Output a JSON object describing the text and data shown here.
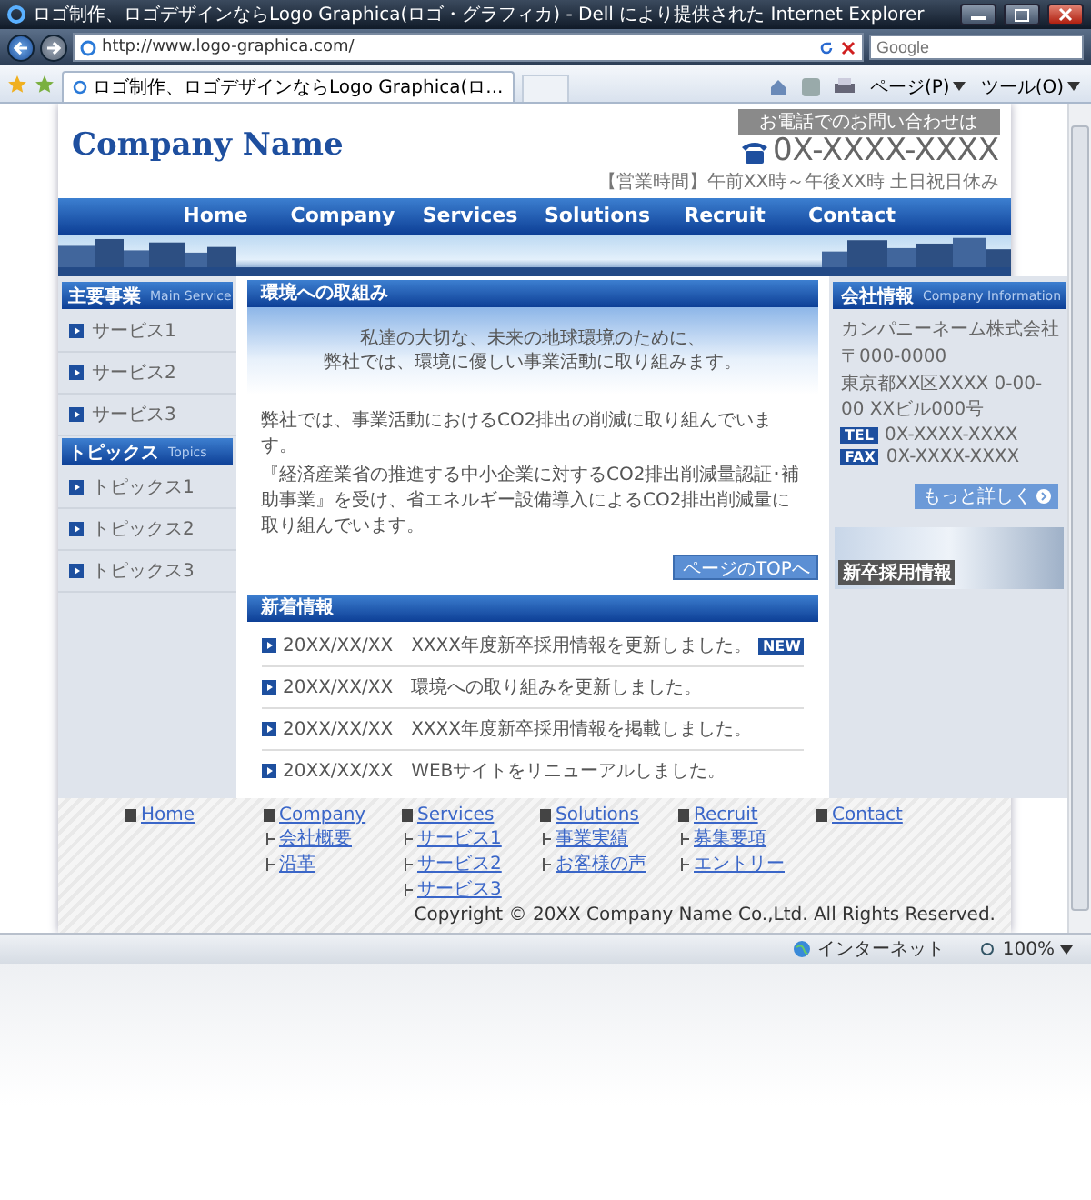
{
  "browser": {
    "title": "ロゴ制作、ロゴデザインならLogo Graphica(ロゴ・グラフィカ) - Dell により提供された Internet Explorer",
    "address": "http://www.logo-graphica.com/",
    "search_placeholder": "Google",
    "tab_title": "ロゴ制作、ロゴデザインならLogo Graphica(ロ...",
    "menus": [
      "ページ(P)",
      "ツール(O)"
    ],
    "status": {
      "zone": "インターネット",
      "zoom": "100%"
    }
  },
  "header": {
    "company": "Company Name",
    "contact_label": "お電話でのお問い合わせは",
    "phone": "0X-XXXX-XXXX",
    "hours": "【営業時間】午前XX時～午後XX時 土日祝日休み"
  },
  "nav": [
    "Home",
    "Company",
    "Services",
    "Solutions",
    "Recruit",
    "Contact"
  ],
  "sidebar": [
    {
      "title": "主要事業",
      "subtitle": "Main Service",
      "items": [
        "サービス1",
        "サービス2",
        "サービス3"
      ]
    },
    {
      "title": "トピックス",
      "subtitle": "Topics",
      "items": [
        "トピックス1",
        "トピックス2",
        "トピックス3"
      ]
    }
  ],
  "main": {
    "title": "環境への取組み",
    "banner_lines": [
      "私達の大切な、未来の地球環境のために、",
      "弊社では、環境に優しい事業活動に取り組みます。"
    ],
    "paragraphs": [
      "弊社では、事業活動におけるCO2排出の削減に取り組んでいます。",
      "『経済産業省の推進する中小企業に対するCO2排出削減量認証･補助事業』を受け、省エネルギー設備導入によるCO2排出削減量に取り組んでいます。"
    ],
    "page_top": "ページのTOPへ"
  },
  "news": {
    "title": "新着情報",
    "badge_label": "NEW",
    "items": [
      {
        "date": "20XX/XX/XX",
        "text": "XXXX年度新卒採用情報を更新しました。",
        "new": true
      },
      {
        "date": "20XX/XX/XX",
        "text": "環境への取り組みを更新しました。",
        "new": false
      },
      {
        "date": "20XX/XX/XX",
        "text": "XXXX年度新卒採用情報を掲載しました。",
        "new": false
      },
      {
        "date": "20XX/XX/XX",
        "text": "WEBサイトをリニューアルしました。",
        "new": false
      }
    ]
  },
  "company_info": {
    "title": "会社情報",
    "subtitle": "Company Information",
    "lines": [
      "カンパニーネーム株式会社",
      "〒000-0000",
      "東京都XX区XXXX 0-00-00 XXビル000号"
    ],
    "contacts": [
      {
        "label": "TEL",
        "value": "0X-XXXX-XXXX"
      },
      {
        "label": "FAX",
        "value": "0X-XXXX-XXXX"
      }
    ],
    "more": "もっと詳しく",
    "recruit_banner": "新卒採用情報"
  },
  "footer": {
    "links": [
      {
        "label": "Home"
      },
      {
        "label": "Company",
        "children": [
          {
            "label": "会社概要"
          },
          {
            "label": "沿革"
          }
        ]
      },
      {
        "label": "Services",
        "children": [
          {
            "label": "サービス1"
          },
          {
            "label": "サービス2"
          },
          {
            "label": "サービス3"
          }
        ]
      },
      {
        "label": "Solutions",
        "children": [
          {
            "label": "事業実績"
          },
          {
            "label": "お客様の声"
          }
        ]
      },
      {
        "label": "Recruit",
        "children": [
          {
            "label": "募集要項"
          },
          {
            "label": "エントリー"
          }
        ]
      },
      {
        "label": "Contact"
      }
    ],
    "copyright": "Copyright ©  20XX Company Name Co.,Ltd. All Rights Reserved."
  }
}
